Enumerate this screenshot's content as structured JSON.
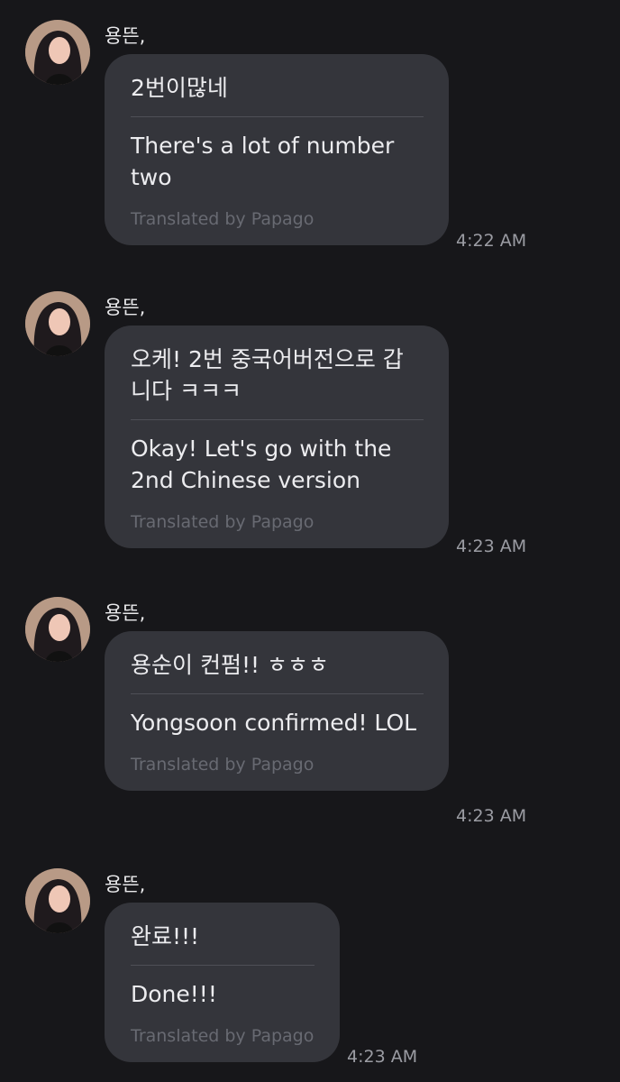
{
  "messages": [
    {
      "sender": "용뜬,",
      "original": "2번이많네",
      "translation": "There's a lot of number two",
      "credit": "Translated by Papago",
      "time": "4:22 AM"
    },
    {
      "sender": "용뜬,",
      "original": "오케! 2번 중국어버전으로 갑니다 ㅋㅋㅋ",
      "translation": "Okay! Let's go with the 2nd Chinese version",
      "credit": "Translated by Papago",
      "time": "4:23 AM"
    },
    {
      "sender": "용뜬,",
      "original": "용순이 컨펌!! ㅎㅎㅎ",
      "translation": "Yongsoon confirmed! LOL",
      "credit": "Translated by Papago",
      "time": "4:23 AM"
    },
    {
      "sender": "용뜬,",
      "original": "완료!!!",
      "translation": "Done!!!",
      "credit": "Translated by Papago",
      "time": "4:23 AM"
    }
  ]
}
